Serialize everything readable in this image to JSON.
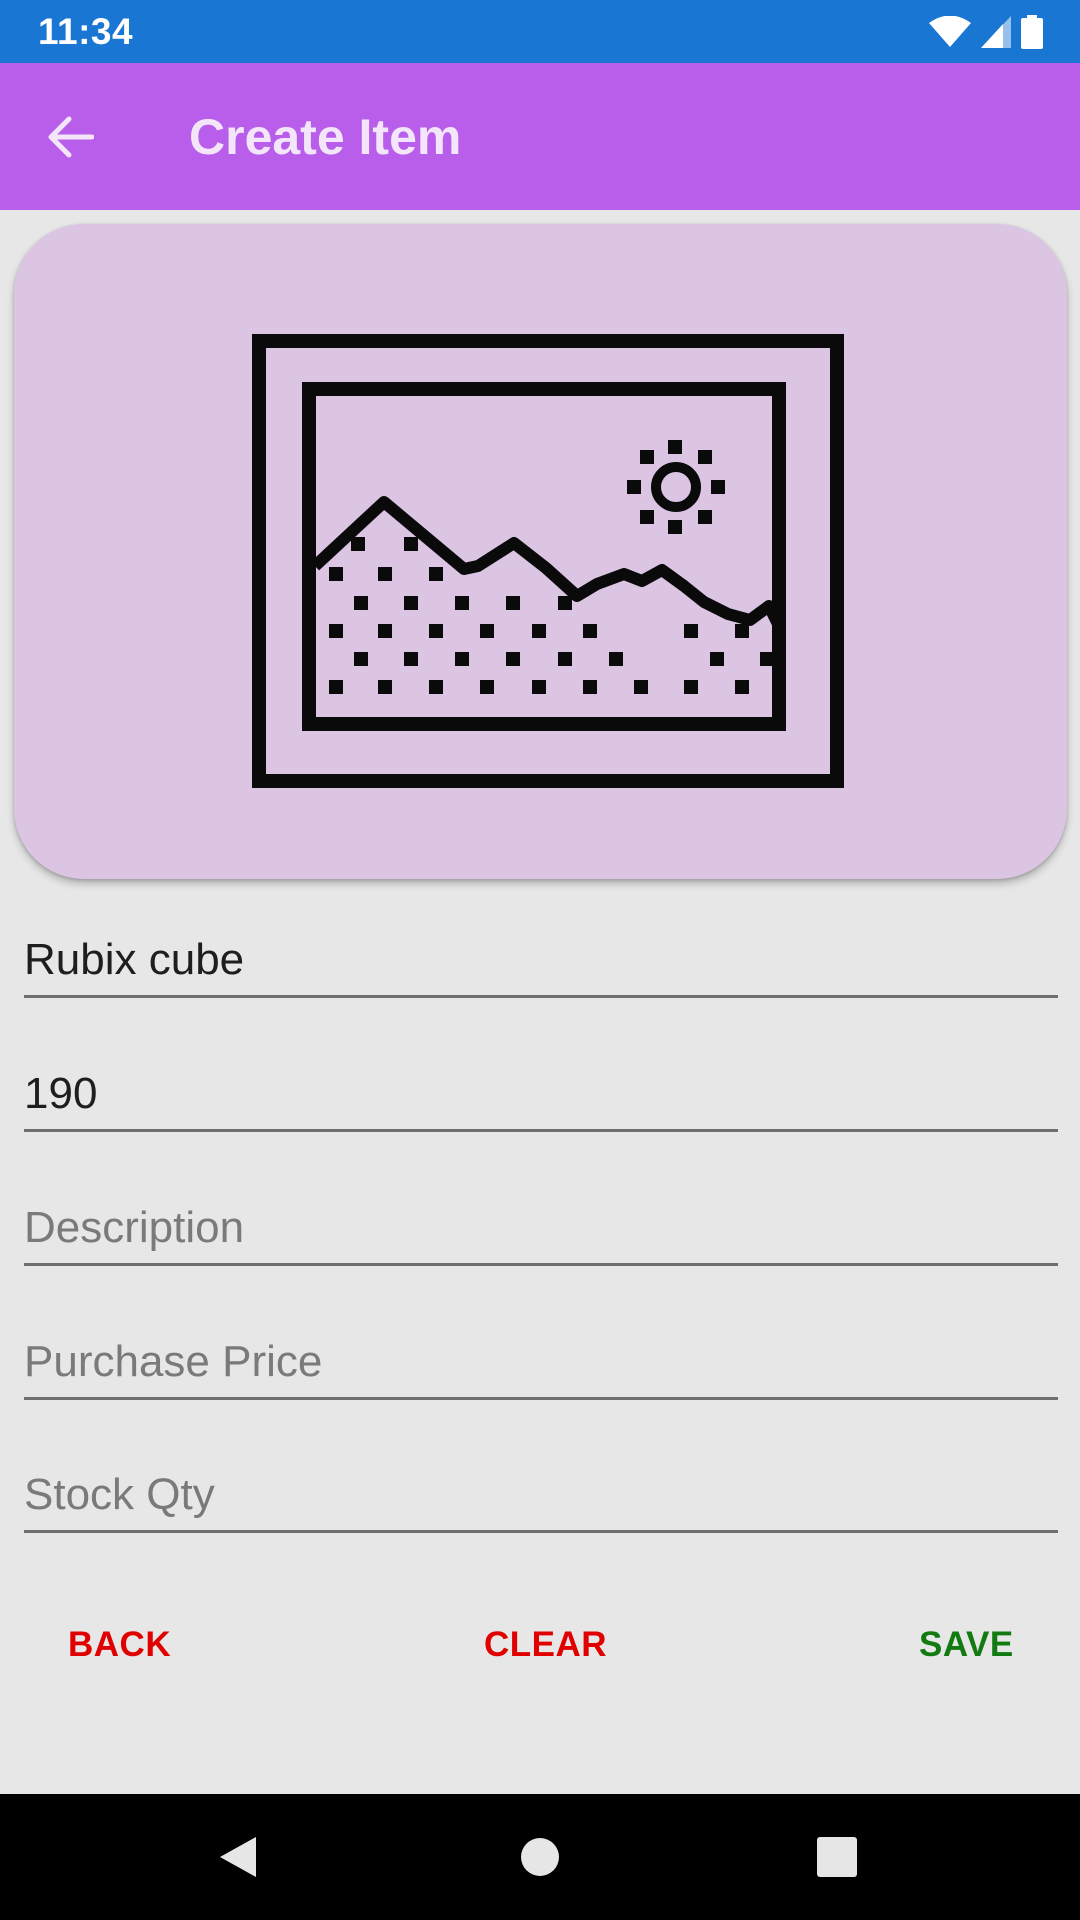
{
  "status_bar": {
    "time": "11:34",
    "icons": [
      "wifi-icon",
      "cellular-signal-icon",
      "battery-icon"
    ]
  },
  "app_bar": {
    "title": "Create Item",
    "back_icon": "arrow-back-icon"
  },
  "image_placeholder": {
    "icon": "image-placeholder-icon"
  },
  "form": {
    "name": {
      "value": "Rubix cube",
      "placeholder": ""
    },
    "quantity": {
      "value": "190",
      "placeholder": ""
    },
    "description": {
      "value": "",
      "placeholder": "Description"
    },
    "purchase_price": {
      "value": "",
      "placeholder": "Purchase Price"
    },
    "stock_qty": {
      "value": "",
      "placeholder": "Stock Qty"
    }
  },
  "buttons": {
    "back": "BACK",
    "clear": "CLEAR",
    "save": "SAVE"
  },
  "nav_bar": {
    "icons": [
      "nav-back-icon",
      "nav-home-icon",
      "nav-recents-icon"
    ]
  },
  "colors": {
    "status_bar": "#1976d2",
    "app_bar": "#b95eea",
    "background": "#e7e7e7",
    "card": "#dbc5e3",
    "icon_stroke": "#0a0a0a",
    "back_button": "#e00000",
    "clear_button": "#e00000",
    "save_button": "#117a11",
    "nav_bar": "#000000",
    "nav_icon": "#e6e6e6"
  }
}
